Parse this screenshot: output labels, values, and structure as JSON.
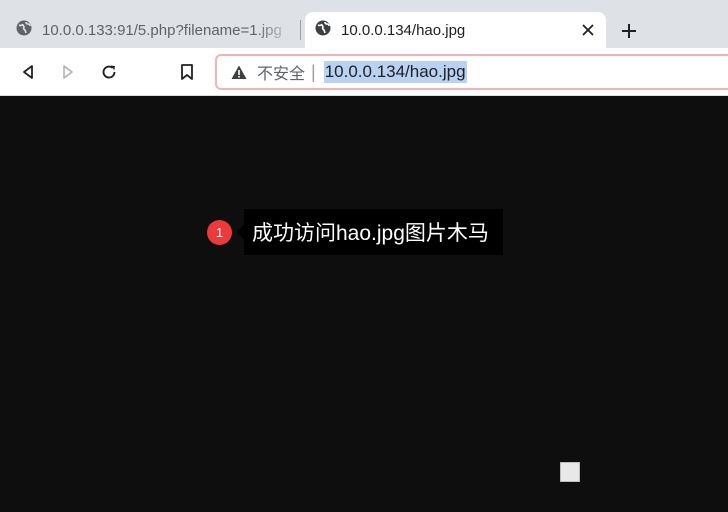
{
  "tabs": [
    {
      "title": "10.0.0.133:91/5.php?filename=1.jpg",
      "icon": "globe-icon",
      "active": false
    },
    {
      "title": "10.0.0.134/hao.jpg",
      "icon": "globe-icon",
      "active": true
    }
  ],
  "toolbar": {
    "security_label": "不安全",
    "separator": "|",
    "url": "10.0.0.134/hao.jpg"
  },
  "annotation": {
    "number": "1",
    "text": "成功访问hao.jpg图片木马",
    "badge_color": "#ec3a3a"
  },
  "colors": {
    "page_background": "#0e0e0e",
    "tabstrip": "#dee1e6",
    "url_highlight": "#b9d2f2"
  }
}
